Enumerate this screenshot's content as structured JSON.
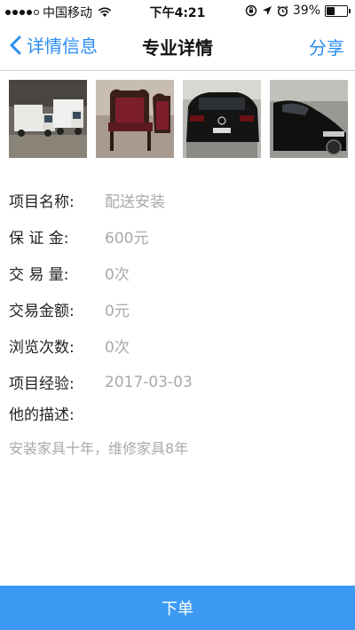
{
  "status_bar": {
    "carrier": "中国移动",
    "time": "下午4:21",
    "battery_percent": "39%",
    "battery_level": 0.39
  },
  "nav": {
    "back_label": "详情信息",
    "title": "专业详情",
    "share_label": "分享",
    "accent_color": "#2a8cf0"
  },
  "photos": [
    {
      "icon": "truck-photo"
    },
    {
      "icon": "chair-photo"
    },
    {
      "icon": "car-rear-photo"
    },
    {
      "icon": "car-side-photo"
    }
  ],
  "details": [
    {
      "label": "项目名称:",
      "value": "配送安装"
    },
    {
      "label": "保 证 金:",
      "value": "600元"
    },
    {
      "label": "交 易 量:",
      "value": "0次"
    },
    {
      "label": "交易金额:",
      "value": "0元"
    },
    {
      "label": "浏览次数:",
      "value": "0次"
    },
    {
      "label": "项目经验:",
      "value": "2017-03-03"
    }
  ],
  "description": {
    "label": "他的描述:",
    "text": "安装家具十年，维修家具8年"
  },
  "order_button": {
    "label": "下单",
    "color": "#3c9af5"
  }
}
